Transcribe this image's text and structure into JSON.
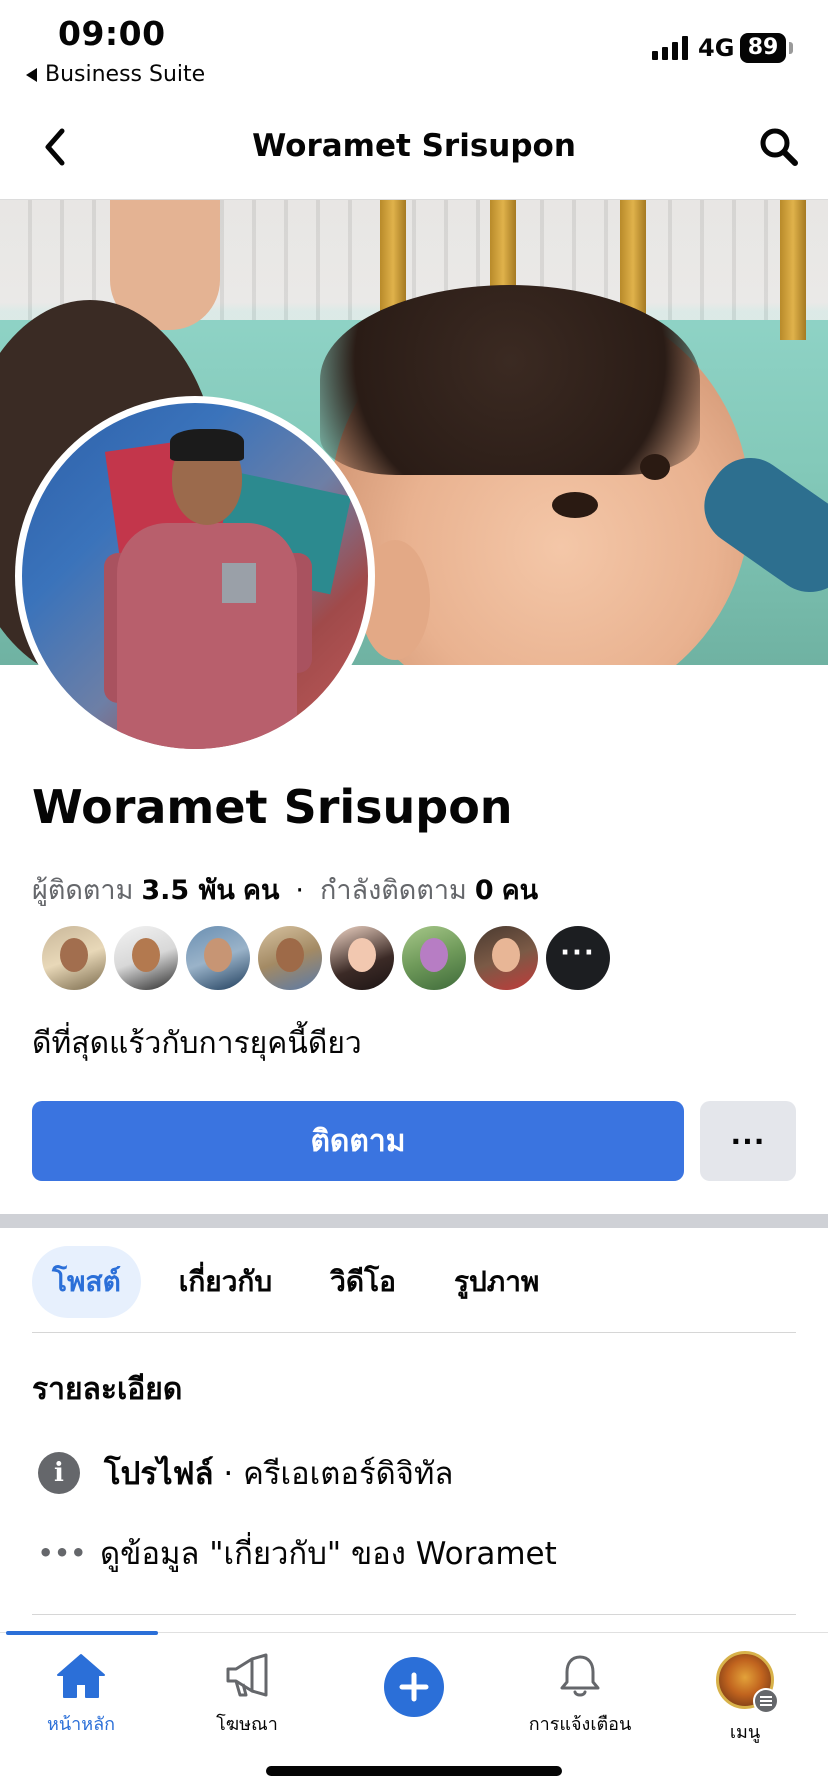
{
  "status_bar": {
    "time": "09:00",
    "back_app_label": "Business Suite",
    "network": "4G",
    "battery": "89"
  },
  "nav": {
    "title": "Woramet Srisupon"
  },
  "profile": {
    "name": "Woramet Srisupon",
    "followers_label": "ผู้ติดตาม",
    "followers_count": "3.5 พัน",
    "followers_unit": "คน",
    "separator": "·",
    "following_label": "กำลังติดตาม",
    "following_count": "0",
    "following_unit": "คน",
    "bio": "ดีที่สุดแร้วกับการยุคนี้ดียว"
  },
  "friends": {
    "avatars": [
      "friend-1",
      "friend-2",
      "friend-3",
      "friend-4",
      "friend-5",
      "friend-6",
      "friend-7"
    ],
    "more_label": "···"
  },
  "actions": {
    "follow_label": "ติดตาม",
    "more_label": "···"
  },
  "tabs": [
    {
      "label": "โพสต์",
      "active": true
    },
    {
      "label": "เกี่ยวกับ",
      "active": false
    },
    {
      "label": "วิดีโอ",
      "active": false
    },
    {
      "label": "รูปภาพ",
      "active": false
    }
  ],
  "details": {
    "title": "รายละเอียด",
    "profile_label": "โปรไฟล์",
    "profile_separator": " · ",
    "profile_category": "ครีเอเตอร์ดิจิทัล",
    "about_label": "ดูข้อมูล \"เกี่ยวกับ\" ของ Woramet"
  },
  "tabbar": {
    "items": [
      {
        "label": "หน้าหลัก",
        "icon": "home-icon",
        "active": true
      },
      {
        "label": "โฆษณา",
        "icon": "megaphone-icon",
        "active": false
      },
      {
        "label": "",
        "icon": "plus-icon",
        "active": false
      },
      {
        "label": "การแจ้งเตือน",
        "icon": "bell-icon",
        "active": false
      },
      {
        "label": "เมนู",
        "icon": "menu-avatar-icon",
        "active": false
      }
    ]
  },
  "colors": {
    "accent": "#2b6fd8",
    "follow_button": "#3a74e0",
    "secondary_button": "#e4e6eb",
    "active_tab_bg": "#e7f0fd"
  }
}
